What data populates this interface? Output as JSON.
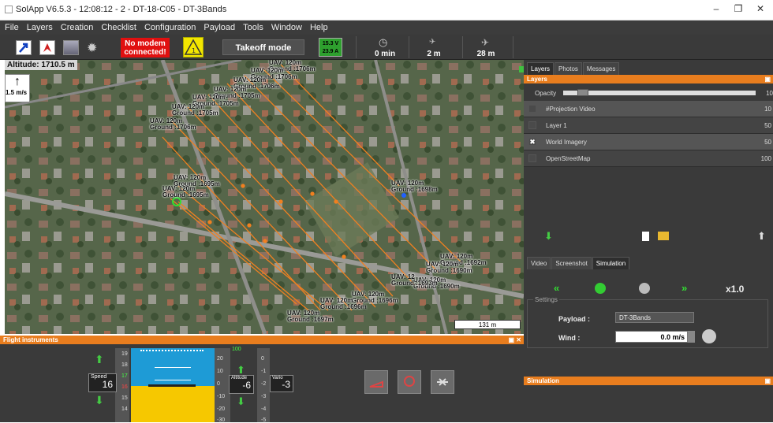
{
  "app": {
    "title": "SolApp V6.5.3 - 12:08:12 - 2 - DT-18-C05 - DT-3Bands",
    "min": "–",
    "max": "❐",
    "close": "✕"
  },
  "menu": [
    "File",
    "Layers",
    "Creation",
    "Checklist",
    "Configuration",
    "Payload",
    "Tools",
    "Window",
    "Help"
  ],
  "toolbar": {
    "modem": "No modem connected!",
    "warn_num": "1",
    "mode": "Takeoff mode",
    "voltage": "15.3 V",
    "current": "23.9 A",
    "time": "0 min",
    "dist1": "2 m",
    "dist2": "28 m"
  },
  "map": {
    "altitude": "Altitude: 1710.5 m",
    "wind": "1.5 m/s",
    "scale": "131 m",
    "labels": [
      "UAV: 120m",
      "Ground :1706m",
      "UAV: 120m",
      "Ground :1706m",
      "UAV: 120m",
      "Ground :1706m",
      "UAV: 120m",
      "Ground :1705m",
      "UAV: 120m",
      "Ground :1705m",
      "UAV: 120m",
      "Ground :1705m",
      "UAV: 120m",
      "Ground :1706m",
      "UAV: 120m",
      "Ground :1695m",
      "UAV: 120m",
      "Ground :1695m",
      "UAV: 120m",
      "Ground :1698m",
      "UAV: 120m",
      "Ground :1692m",
      "UAV: 120m",
      "Ground :1690m",
      "UAV: 120m",
      "Ground :1690m",
      "UAV: 12",
      "Ground :1693m",
      "UAV: 120m",
      "Ground :1696m",
      "UAV: 120m",
      "Ground :1696m",
      "UAV: 120m",
      "Ground :1697m"
    ]
  },
  "right": {
    "tabs": [
      "Layers",
      "Photos",
      "Messages"
    ],
    "layers_hdr": "Layers",
    "opacity": "Opacity",
    "opacity_val": "10",
    "layers": [
      {
        "name": "#Projection Video",
        "pct": "10",
        "checked": ""
      },
      {
        "name": "Layer 1",
        "pct": "50",
        "checked": ""
      },
      {
        "name": "World Imagery",
        "pct": "50",
        "checked": "✖"
      },
      {
        "name": "OpenStreetMap",
        "pct": "100",
        "checked": ""
      }
    ],
    "sim_tabs": [
      "Video",
      "Screenshot",
      "Simulation"
    ],
    "sim_hdr": "Simulation",
    "speed": "x1.0",
    "settings": "Settings",
    "payload_lbl": "Payload :",
    "payload_val": "DT-3Bands",
    "wind_lbl": "Wind :",
    "wind_val": "0.0 m/s"
  },
  "flight": {
    "hdr": "Flight instruments",
    "speed_lbl": "Speed",
    "speed_val": "16",
    "alt_lbl": "Altitude",
    "alt_val": "-6",
    "vario_lbl": "Vario",
    "vario_val": "-3",
    "speed_ticks": [
      "19",
      "18",
      "17",
      "16",
      "15",
      "14"
    ],
    "alt_ticks": [
      "20",
      "10",
      "0",
      "-10",
      "-20",
      "-30"
    ],
    "vario_ticks": [
      "0",
      "-1",
      "-2",
      "-3",
      "-4",
      "-5"
    ],
    "alt_top": "100"
  },
  "colors": {
    "accent": "#e87d1e",
    "path": "#f08020",
    "modem": "#e01010",
    "battery": "#2ea02e"
  }
}
